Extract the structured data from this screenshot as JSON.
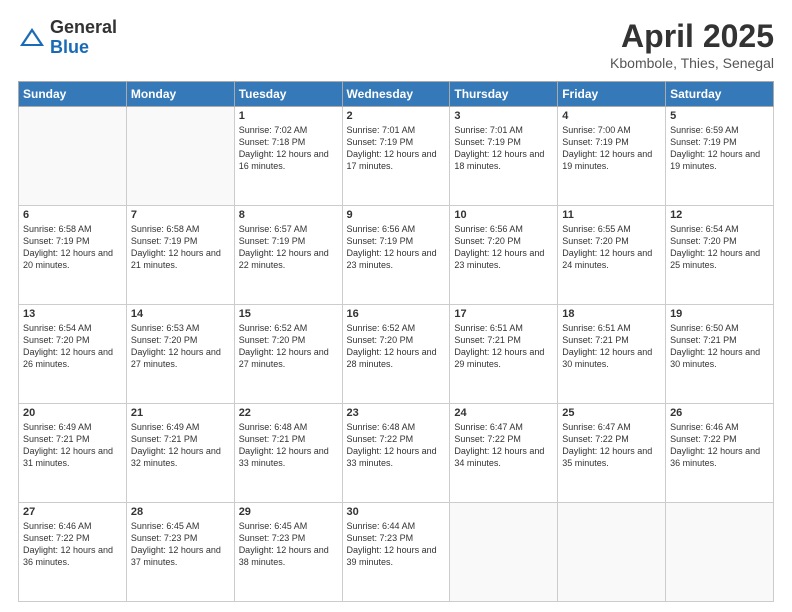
{
  "logo": {
    "general": "General",
    "blue": "Blue"
  },
  "header": {
    "month": "April 2025",
    "location": "Kbombole, Thies, Senegal"
  },
  "weekdays": [
    "Sunday",
    "Monday",
    "Tuesday",
    "Wednesday",
    "Thursday",
    "Friday",
    "Saturday"
  ],
  "weeks": [
    [
      {
        "day": "",
        "sunrise": "",
        "sunset": "",
        "daylight": ""
      },
      {
        "day": "",
        "sunrise": "",
        "sunset": "",
        "daylight": ""
      },
      {
        "day": "1",
        "sunrise": "Sunrise: 7:02 AM",
        "sunset": "Sunset: 7:18 PM",
        "daylight": "Daylight: 12 hours and 16 minutes."
      },
      {
        "day": "2",
        "sunrise": "Sunrise: 7:01 AM",
        "sunset": "Sunset: 7:19 PM",
        "daylight": "Daylight: 12 hours and 17 minutes."
      },
      {
        "day": "3",
        "sunrise": "Sunrise: 7:01 AM",
        "sunset": "Sunset: 7:19 PM",
        "daylight": "Daylight: 12 hours and 18 minutes."
      },
      {
        "day": "4",
        "sunrise": "Sunrise: 7:00 AM",
        "sunset": "Sunset: 7:19 PM",
        "daylight": "Daylight: 12 hours and 19 minutes."
      },
      {
        "day": "5",
        "sunrise": "Sunrise: 6:59 AM",
        "sunset": "Sunset: 7:19 PM",
        "daylight": "Daylight: 12 hours and 19 minutes."
      }
    ],
    [
      {
        "day": "6",
        "sunrise": "Sunrise: 6:58 AM",
        "sunset": "Sunset: 7:19 PM",
        "daylight": "Daylight: 12 hours and 20 minutes."
      },
      {
        "day": "7",
        "sunrise": "Sunrise: 6:58 AM",
        "sunset": "Sunset: 7:19 PM",
        "daylight": "Daylight: 12 hours and 21 minutes."
      },
      {
        "day": "8",
        "sunrise": "Sunrise: 6:57 AM",
        "sunset": "Sunset: 7:19 PM",
        "daylight": "Daylight: 12 hours and 22 minutes."
      },
      {
        "day": "9",
        "sunrise": "Sunrise: 6:56 AM",
        "sunset": "Sunset: 7:19 PM",
        "daylight": "Daylight: 12 hours and 23 minutes."
      },
      {
        "day": "10",
        "sunrise": "Sunrise: 6:56 AM",
        "sunset": "Sunset: 7:20 PM",
        "daylight": "Daylight: 12 hours and 23 minutes."
      },
      {
        "day": "11",
        "sunrise": "Sunrise: 6:55 AM",
        "sunset": "Sunset: 7:20 PM",
        "daylight": "Daylight: 12 hours and 24 minutes."
      },
      {
        "day": "12",
        "sunrise": "Sunrise: 6:54 AM",
        "sunset": "Sunset: 7:20 PM",
        "daylight": "Daylight: 12 hours and 25 minutes."
      }
    ],
    [
      {
        "day": "13",
        "sunrise": "Sunrise: 6:54 AM",
        "sunset": "Sunset: 7:20 PM",
        "daylight": "Daylight: 12 hours and 26 minutes."
      },
      {
        "day": "14",
        "sunrise": "Sunrise: 6:53 AM",
        "sunset": "Sunset: 7:20 PM",
        "daylight": "Daylight: 12 hours and 27 minutes."
      },
      {
        "day": "15",
        "sunrise": "Sunrise: 6:52 AM",
        "sunset": "Sunset: 7:20 PM",
        "daylight": "Daylight: 12 hours and 27 minutes."
      },
      {
        "day": "16",
        "sunrise": "Sunrise: 6:52 AM",
        "sunset": "Sunset: 7:20 PM",
        "daylight": "Daylight: 12 hours and 28 minutes."
      },
      {
        "day": "17",
        "sunrise": "Sunrise: 6:51 AM",
        "sunset": "Sunset: 7:21 PM",
        "daylight": "Daylight: 12 hours and 29 minutes."
      },
      {
        "day": "18",
        "sunrise": "Sunrise: 6:51 AM",
        "sunset": "Sunset: 7:21 PM",
        "daylight": "Daylight: 12 hours and 30 minutes."
      },
      {
        "day": "19",
        "sunrise": "Sunrise: 6:50 AM",
        "sunset": "Sunset: 7:21 PM",
        "daylight": "Daylight: 12 hours and 30 minutes."
      }
    ],
    [
      {
        "day": "20",
        "sunrise": "Sunrise: 6:49 AM",
        "sunset": "Sunset: 7:21 PM",
        "daylight": "Daylight: 12 hours and 31 minutes."
      },
      {
        "day": "21",
        "sunrise": "Sunrise: 6:49 AM",
        "sunset": "Sunset: 7:21 PM",
        "daylight": "Daylight: 12 hours and 32 minutes."
      },
      {
        "day": "22",
        "sunrise": "Sunrise: 6:48 AM",
        "sunset": "Sunset: 7:21 PM",
        "daylight": "Daylight: 12 hours and 33 minutes."
      },
      {
        "day": "23",
        "sunrise": "Sunrise: 6:48 AM",
        "sunset": "Sunset: 7:22 PM",
        "daylight": "Daylight: 12 hours and 33 minutes."
      },
      {
        "day": "24",
        "sunrise": "Sunrise: 6:47 AM",
        "sunset": "Sunset: 7:22 PM",
        "daylight": "Daylight: 12 hours and 34 minutes."
      },
      {
        "day": "25",
        "sunrise": "Sunrise: 6:47 AM",
        "sunset": "Sunset: 7:22 PM",
        "daylight": "Daylight: 12 hours and 35 minutes."
      },
      {
        "day": "26",
        "sunrise": "Sunrise: 6:46 AM",
        "sunset": "Sunset: 7:22 PM",
        "daylight": "Daylight: 12 hours and 36 minutes."
      }
    ],
    [
      {
        "day": "27",
        "sunrise": "Sunrise: 6:46 AM",
        "sunset": "Sunset: 7:22 PM",
        "daylight": "Daylight: 12 hours and 36 minutes."
      },
      {
        "day": "28",
        "sunrise": "Sunrise: 6:45 AM",
        "sunset": "Sunset: 7:23 PM",
        "daylight": "Daylight: 12 hours and 37 minutes."
      },
      {
        "day": "29",
        "sunrise": "Sunrise: 6:45 AM",
        "sunset": "Sunset: 7:23 PM",
        "daylight": "Daylight: 12 hours and 38 minutes."
      },
      {
        "day": "30",
        "sunrise": "Sunrise: 6:44 AM",
        "sunset": "Sunset: 7:23 PM",
        "daylight": "Daylight: 12 hours and 39 minutes."
      },
      {
        "day": "",
        "sunrise": "",
        "sunset": "",
        "daylight": ""
      },
      {
        "day": "",
        "sunrise": "",
        "sunset": "",
        "daylight": ""
      },
      {
        "day": "",
        "sunrise": "",
        "sunset": "",
        "daylight": ""
      }
    ]
  ]
}
